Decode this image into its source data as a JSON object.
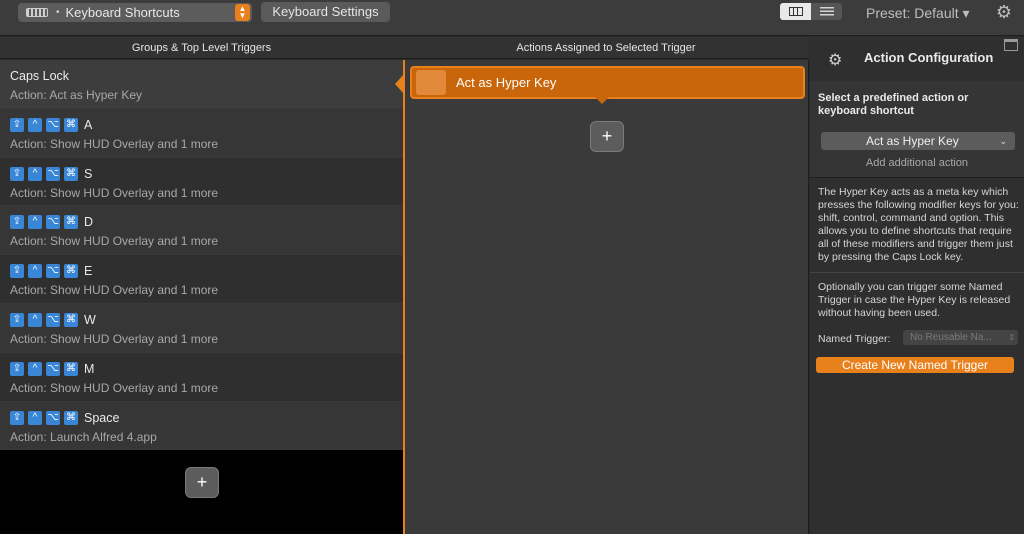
{
  "toolbar": {
    "type_select_bullet": "•",
    "type_select_label": "Keyboard Shortcuts",
    "settings_button": "Keyboard Settings",
    "preset_label": "Preset: Default ▾",
    "gear_glyph": "⚙",
    "stepper_glyph": "▲▼"
  },
  "columns": {
    "left_header": "Groups & Top Level Triggers",
    "middle_header": "Actions Assigned to Selected Trigger"
  },
  "modifier_keys": [
    "⇪",
    "^",
    "⌥",
    "⌘"
  ],
  "triggers": [
    {
      "title": "Caps Lock",
      "key": "",
      "action": "Action: Act as Hyper Key",
      "modifiers": false,
      "selected": true
    },
    {
      "title": "",
      "key": "A",
      "action": "Action: Show HUD Overlay and 1 more",
      "modifiers": true,
      "selected": false
    },
    {
      "title": "",
      "key": "S",
      "action": "Action: Show HUD Overlay and 1 more",
      "modifiers": true,
      "selected": false
    },
    {
      "title": "",
      "key": "D",
      "action": "Action: Show HUD Overlay and 1 more",
      "modifiers": true,
      "selected": false
    },
    {
      "title": "",
      "key": "E",
      "action": "Action: Show HUD Overlay and 1 more",
      "modifiers": true,
      "selected": false
    },
    {
      "title": "",
      "key": "W",
      "action": "Action: Show HUD Overlay and 1 more",
      "modifiers": true,
      "selected": false
    },
    {
      "title": "",
      "key": "M",
      "action": "Action: Show HUD Overlay and 1 more",
      "modifiers": true,
      "selected": false
    },
    {
      "title": "",
      "key": "Space",
      "action": "Action: Launch Alfred 4.app",
      "modifiers": true,
      "selected": false
    }
  ],
  "add_glyph": "+",
  "assigned_actions": [
    {
      "label": "Act as Hyper Key"
    }
  ],
  "config": {
    "title": "Action Configuration",
    "prompt": "Select a predefined action or keyboard shortcut",
    "selected_action": "Act as Hyper Key",
    "select_chevron": "⌄",
    "add_additional": "Add additional action",
    "description": "The Hyper Key acts as a meta key which presses the following modifier keys for you: shift, control, command and option. This allows you to define shortcuts that require all of these modifiers and trigger them just by pressing the Caps Lock key.",
    "optional_text": "Optionally you can trigger some Named Trigger in case the Hyper Key is released without having been used.",
    "named_trigger_label": "Named Trigger:",
    "named_trigger_value": "No Reusable Na...",
    "named_trigger_chevron": "⇕",
    "create_button": "Create New Named Trigger"
  },
  "colors": {
    "accent": "#e8801c",
    "key_blue": "#3a86d6",
    "action_card": "#c9650a"
  }
}
